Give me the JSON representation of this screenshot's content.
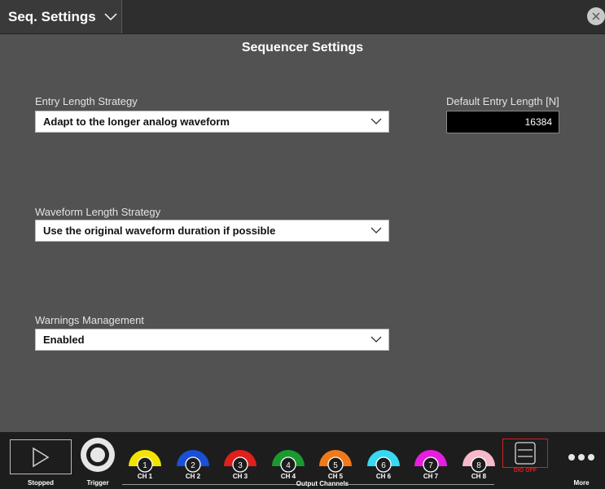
{
  "titlebar": {
    "title": "Seq. Settings"
  },
  "section_title": "Sequencer Settings",
  "entry_length": {
    "label": "Entry Length Strategy",
    "value": "Adapt to the longer analog waveform"
  },
  "default_entry_length": {
    "label": "Default Entry Length [N]",
    "value": "16384"
  },
  "waveform_length": {
    "label": "Waveform Length Strategy",
    "value": "Use the original waveform duration if possible"
  },
  "warnings": {
    "label": "Warnings Management",
    "value": "Enabled"
  },
  "toolbar": {
    "stopped_label": "Stopped",
    "trigger_label": "Trigger",
    "output_channels_label": "Output Channels",
    "dio_label": "DIO OFF",
    "more_label": "More",
    "channels": [
      {
        "number": "1",
        "label": "CH 1",
        "color": "#f2e400"
      },
      {
        "number": "2",
        "label": "CH 2",
        "color": "#1a4fd6"
      },
      {
        "number": "3",
        "label": "CH 3",
        "color": "#e0201c"
      },
      {
        "number": "4",
        "label": "CH 4",
        "color": "#1a9a2e"
      },
      {
        "number": "5",
        "label": "CH 5",
        "color": "#f07a1a"
      },
      {
        "number": "6",
        "label": "CH 6",
        "color": "#38d8f0"
      },
      {
        "number": "7",
        "label": "CH 7",
        "color": "#e61ee0"
      },
      {
        "number": "8",
        "label": "CH 8",
        "color": "#f7b9c9"
      }
    ]
  },
  "icons": [
    "chevron-down-icon",
    "close-icon",
    "play-icon",
    "trigger-icon",
    "dio-icon",
    "more-icon"
  ],
  "colors": {
    "background": "#525252",
    "titlebar": "#2e2e2e",
    "toolbar": "#1d1d1d",
    "dio_accent": "#d42020"
  }
}
